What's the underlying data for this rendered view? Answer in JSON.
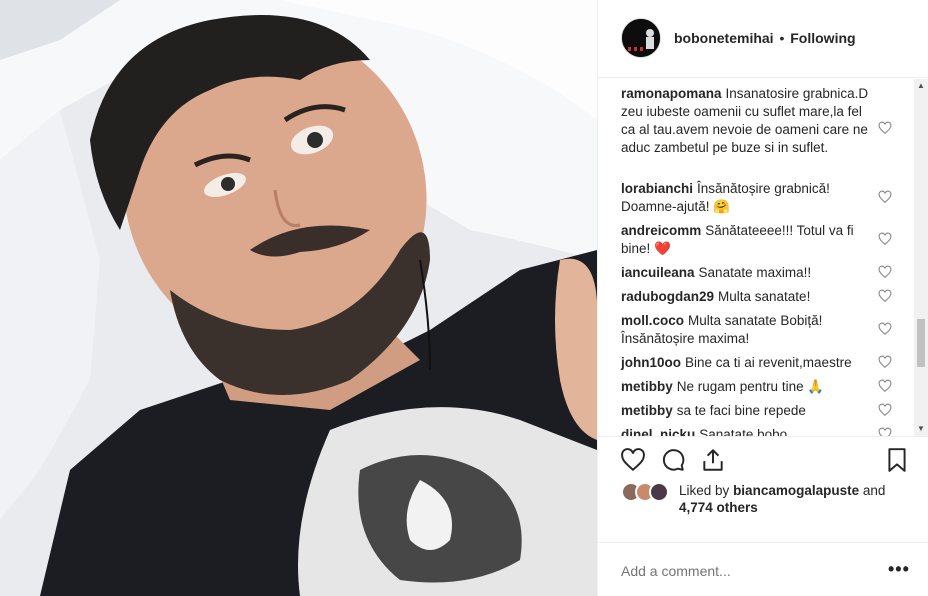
{
  "header": {
    "username": "bobonetemihai",
    "separator": "•",
    "follow_status": "Following"
  },
  "comments": [
    {
      "user": "ramonapomana",
      "text": "Insanatosire grabnica.D zeu iubeste oamenii cu suflet mare,la fel ca al tau.avem nevoie de oameni care ne aduc zambetul pe buze si in suflet."
    },
    {
      "user": "lorabianchi",
      "text": "Însănătoșire grabnică! Doamne-ajută! 🤗"
    },
    {
      "user": "andreicomm",
      "text": "Sănătateeee!!! Totul va fi bine! ❤️"
    },
    {
      "user": "iancuileana",
      "text": "Sanatate maxima!!"
    },
    {
      "user": "radubogdan29",
      "text": "Multa sanatate!"
    },
    {
      "user": "moll.coco",
      "text": "Multa sanatate Bobiță! Însănătoșire maxima!"
    },
    {
      "user": "john10oo",
      "text": "Bine ca ti ai revenit,maestre"
    },
    {
      "user": "metibby",
      "text": "Ne rugam pentru tine 🙏"
    },
    {
      "user": "metibby",
      "text": "sa te faci bine repede"
    },
    {
      "user": "dinel_nicku",
      "text": "Sanatate bobo"
    }
  ],
  "likes": {
    "prefix": "Liked by",
    "user": "biancamogalapuste",
    "and": "and",
    "others": "4,774 others"
  },
  "add_comment": {
    "placeholder": "Add a comment..."
  },
  "more_label": "•••",
  "scroll": {
    "up": "▲",
    "down": "▼"
  }
}
